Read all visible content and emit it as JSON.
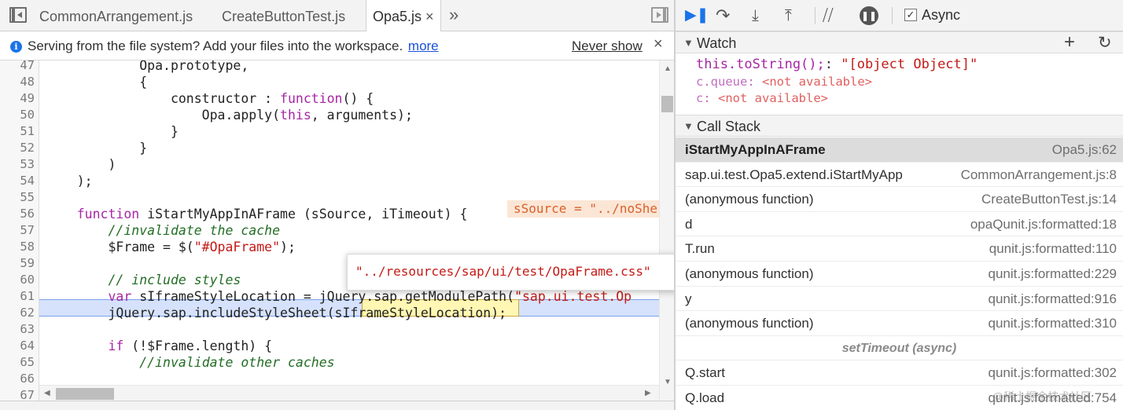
{
  "tabs": [
    {
      "label": "CommonArrangement.js",
      "active": false
    },
    {
      "label": "CreateButtonTest.js",
      "active": false
    },
    {
      "label": "Opa5.js",
      "active": true,
      "close": "×"
    }
  ],
  "tab_overflow": "»",
  "infobar": {
    "text": "Serving from the file system? Add your files into the workspace.",
    "link": "more",
    "never_show": "Never show",
    "close": "×",
    "icon": "info-icon"
  },
  "editor": {
    "lines": [
      {
        "n": "47",
        "code": "            Opa.prototype,"
      },
      {
        "n": "48",
        "code": "            {"
      },
      {
        "n": "49",
        "code": "                constructor : function() {"
      },
      {
        "n": "50",
        "code": "                    Opa.apply(this, arguments);"
      },
      {
        "n": "51",
        "code": "                }"
      },
      {
        "n": "52",
        "code": "            }"
      },
      {
        "n": "53",
        "code": "        )"
      },
      {
        "n": "54",
        "code": "    );"
      },
      {
        "n": "55",
        "code": ""
      },
      {
        "n": "56",
        "code": "    function iStartMyAppInAFrame (sSource, iTimeout) {"
      },
      {
        "n": "57",
        "code": "        //invalidate the cache"
      },
      {
        "n": "58",
        "code": "        $Frame = $(\"#OpaFrame\");"
      },
      {
        "n": "59",
        "code": ""
      },
      {
        "n": "60",
        "code": "        // include styles"
      },
      {
        "n": "61",
        "code": "        var sIframeStyleLocation = jQuery.sap.getModulePath(\"sap.ui.test.Op"
      },
      {
        "n": "62",
        "code": "        jQuery.sap.includeStyleSheet(sIframeStyleLocation);"
      },
      {
        "n": "63",
        "code": ""
      },
      {
        "n": "64",
        "code": "        if (!$Frame.length) {"
      },
      {
        "n": "65",
        "code": "            //invalidate other caches"
      },
      {
        "n": "66",
        "code": ""
      },
      {
        "n": "67",
        "code": ""
      }
    ],
    "execution_line": "62",
    "inline_value": "sSource = \"../noShe",
    "popover_value": "\"../resources/sap/ui/test/OpaFrame.css\""
  },
  "debugger": {
    "async_label": "Async",
    "async_checked": true,
    "buttons": [
      {
        "name": "resume-icon"
      },
      {
        "name": "step-over-icon"
      },
      {
        "name": "step-into-icon"
      },
      {
        "name": "step-out-icon"
      },
      {
        "name": "deactivate-breakpoints-icon"
      },
      {
        "name": "pause-on-exceptions-icon"
      }
    ]
  },
  "watch": {
    "title": "Watch",
    "add": "+",
    "refresh": "↻",
    "rows": [
      {
        "name": "this.toString();",
        "sep": ": ",
        "value": "\"[object Object]\""
      },
      {
        "name": "c.queue",
        "sep": ": ",
        "value": "<not available>"
      },
      {
        "name": "c",
        "sep": ": ",
        "value": "<not available>"
      }
    ]
  },
  "call_stack": {
    "title": "Call Stack",
    "frames": [
      {
        "name": "iStartMyAppInAFrame",
        "location": "Opa5.js:62",
        "selected": true
      },
      {
        "name": "sap.ui.test.Opa5.extend.iStartMyApp",
        "location": "CommonArrangement.js:8"
      },
      {
        "name": "(anonymous function)",
        "location": "CreateButtonTest.js:14"
      },
      {
        "name": "d",
        "location": "opaQunit.js:formatted:18"
      },
      {
        "name": "T.run",
        "location": "qunit.js:formatted:110"
      },
      {
        "name": "(anonymous function)",
        "location": "qunit.js:formatted:229"
      },
      {
        "name": "y",
        "location": "qunit.js:formatted:916"
      },
      {
        "name": "(anonymous function)",
        "location": "qunit.js:formatted:310"
      },
      {
        "async": "setTimeout (async)"
      },
      {
        "name": "Q.start",
        "location": "qunit.js:formatted:302"
      },
      {
        "name": "Q.load",
        "location": "qunit.js:formatted:754"
      }
    ]
  },
  "watermark": "@稀土掘金技术社区"
}
